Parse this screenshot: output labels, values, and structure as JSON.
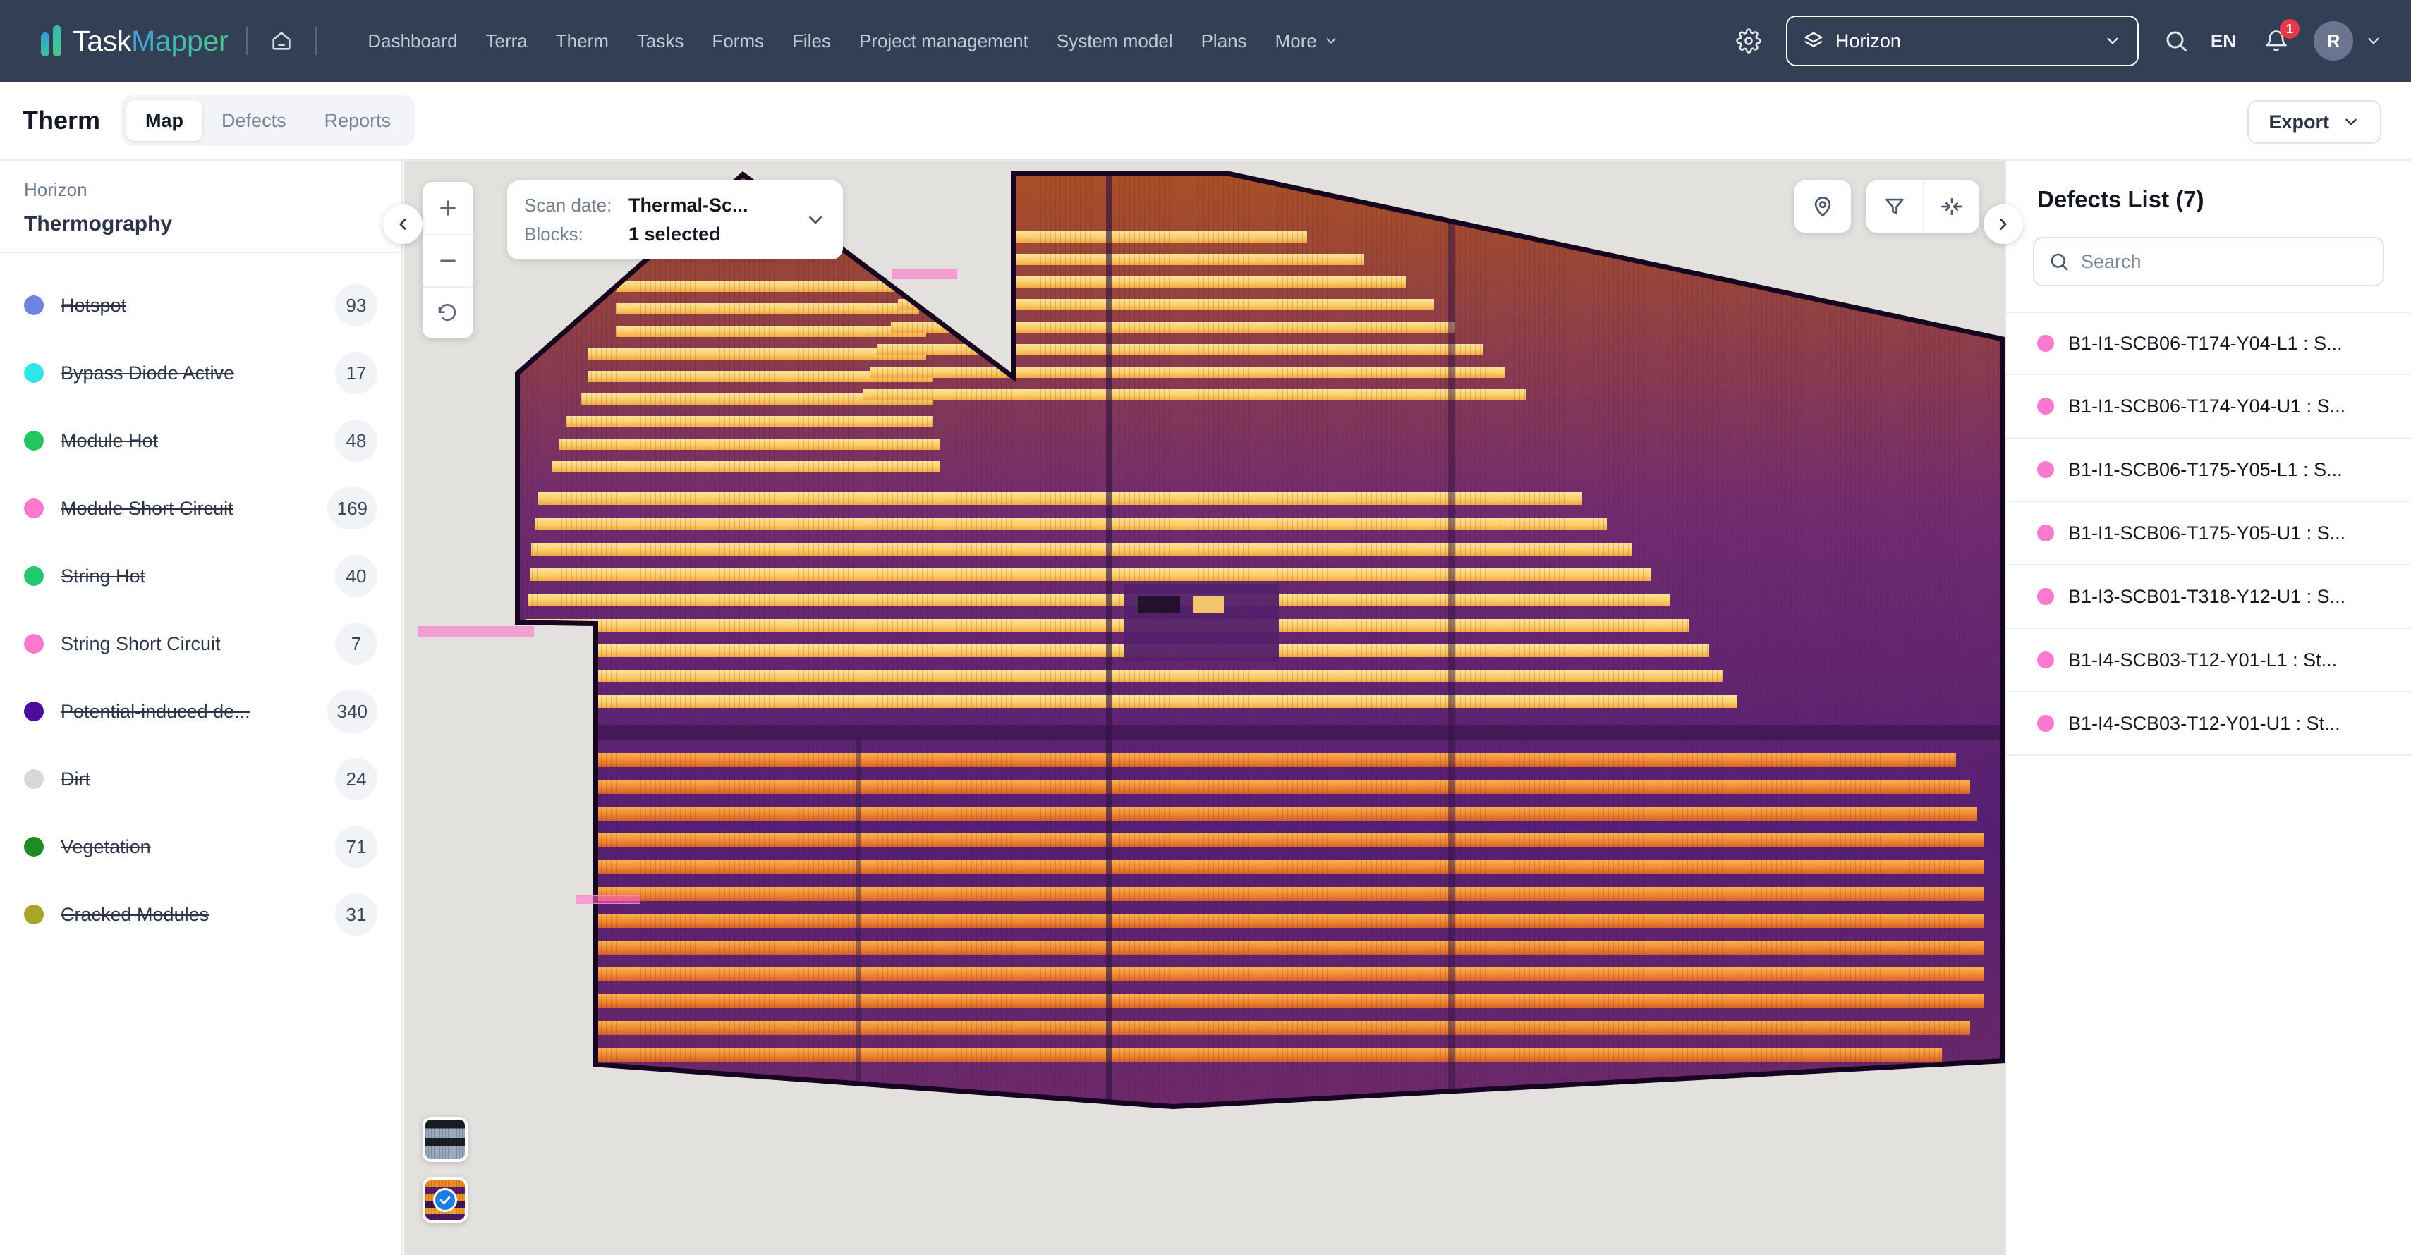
{
  "app": {
    "brand_primary": "Task",
    "brand_secondary": "Mapper",
    "brand_color_start": "#4aa3e0",
    "brand_color_end": "#4cc98d",
    "navbar_bg": "#333f54"
  },
  "topnav": {
    "home_icon": "home-icon",
    "links": [
      {
        "label": "Dashboard"
      },
      {
        "label": "Terra"
      },
      {
        "label": "Therm"
      },
      {
        "label": "Tasks"
      },
      {
        "label": "Forms"
      },
      {
        "label": "Files"
      },
      {
        "label": "Project management"
      },
      {
        "label": "System model"
      },
      {
        "label": "Plans"
      },
      {
        "label": "More",
        "has_chevron": true
      }
    ],
    "settings_icon": "gear-icon",
    "project_selector": {
      "icon": "layers-icon",
      "value": "Horizon",
      "chevron": "chevron-down-icon"
    },
    "search_icon": "search-icon",
    "language": "EN",
    "notifications": {
      "icon": "bell-icon",
      "count": "1",
      "badge_color": "#e8394a"
    },
    "avatar": {
      "initial": "R",
      "chevron": "chevron-down-icon"
    }
  },
  "subheader": {
    "title": "Therm",
    "tabs": [
      {
        "label": "Map",
        "active": true
      },
      {
        "label": "Defects",
        "active": false
      },
      {
        "label": "Reports",
        "active": false
      }
    ],
    "export": {
      "label": "Export",
      "chevron": "chevron-down-icon"
    }
  },
  "sidebar": {
    "project": "Horizon",
    "section": "Thermography",
    "collapse_icon": "chevron-left-icon",
    "legend": [
      {
        "label": "Hotspot",
        "count": "93",
        "color": "#6d85e0",
        "struck": true
      },
      {
        "label": "Bypass Diode Active",
        "count": "17",
        "color": "#2fe5e8",
        "struck": true
      },
      {
        "label": "Module Hot",
        "count": "48",
        "color": "#23c55e",
        "struck": true
      },
      {
        "label": "Module Short Circuit",
        "count": "169",
        "color": "#fb7ad0",
        "struck": true
      },
      {
        "label": "String Hot",
        "count": "40",
        "color": "#22c96a",
        "struck": true
      },
      {
        "label": "String Short Circuit",
        "count": "7",
        "color": "#fb7ad0",
        "struck": false
      },
      {
        "label": "Potential-induced de...",
        "count": "340",
        "color": "#4c0c9c",
        "struck": true
      },
      {
        "label": "Dirt",
        "count": "24",
        "color": "#d6d8dc",
        "struck": true
      },
      {
        "label": "Vegetation",
        "count": "71",
        "color": "#1f8b22",
        "struck": true
      },
      {
        "label": "Cracked Modules",
        "count": "31",
        "color": "#a9a42c",
        "struck": true
      }
    ]
  },
  "map": {
    "background_color": "#e3e1dd",
    "zoom_controls": [
      {
        "name": "zoom-in-icon",
        "glyph": "+"
      },
      {
        "name": "zoom-out-icon",
        "glyph": "−"
      },
      {
        "name": "reset-view-icon",
        "glyph": "↺"
      }
    ],
    "scan_card": {
      "scan_date_label": "Scan date:",
      "scan_date_value": "Thermal-Sc...",
      "blocks_label": "Blocks:",
      "blocks_value": "1 selected",
      "chevron": "chevron-down-icon"
    },
    "tools": [
      {
        "name": "map-pin-icon"
      },
      {
        "name": "filter-icon"
      },
      {
        "name": "collapse-horizontal-icon"
      }
    ],
    "layers": [
      {
        "name": "rgb-layer-thumbnail",
        "selected": false
      },
      {
        "name": "thermal-layer-thumbnail",
        "selected": true
      }
    ],
    "defect_marker_color": "#ff69c8"
  },
  "defects_panel": {
    "title": "Defects List (7)",
    "collapse_icon": "chevron-right-icon",
    "search": {
      "icon": "search-icon",
      "placeholder": "Search",
      "value": ""
    },
    "items": [
      {
        "label": "B1-I1-SCB06-T174-Y04-L1 : S...",
        "color": "#fb7ad0"
      },
      {
        "label": "B1-I1-SCB06-T174-Y04-U1 : S...",
        "color": "#fb7ad0"
      },
      {
        "label": "B1-I1-SCB06-T175-Y05-L1 : S...",
        "color": "#fb7ad0"
      },
      {
        "label": "B1-I1-SCB06-T175-Y05-U1 : S...",
        "color": "#fb7ad0"
      },
      {
        "label": "B1-I3-SCB01-T318-Y12-U1 : S...",
        "color": "#fb7ad0"
      },
      {
        "label": "B1-I4-SCB03-T12-Y01-L1 : St...",
        "color": "#fb7ad0"
      },
      {
        "label": "B1-I4-SCB03-T12-Y01-U1 : St...",
        "color": "#fb7ad0"
      }
    ]
  }
}
